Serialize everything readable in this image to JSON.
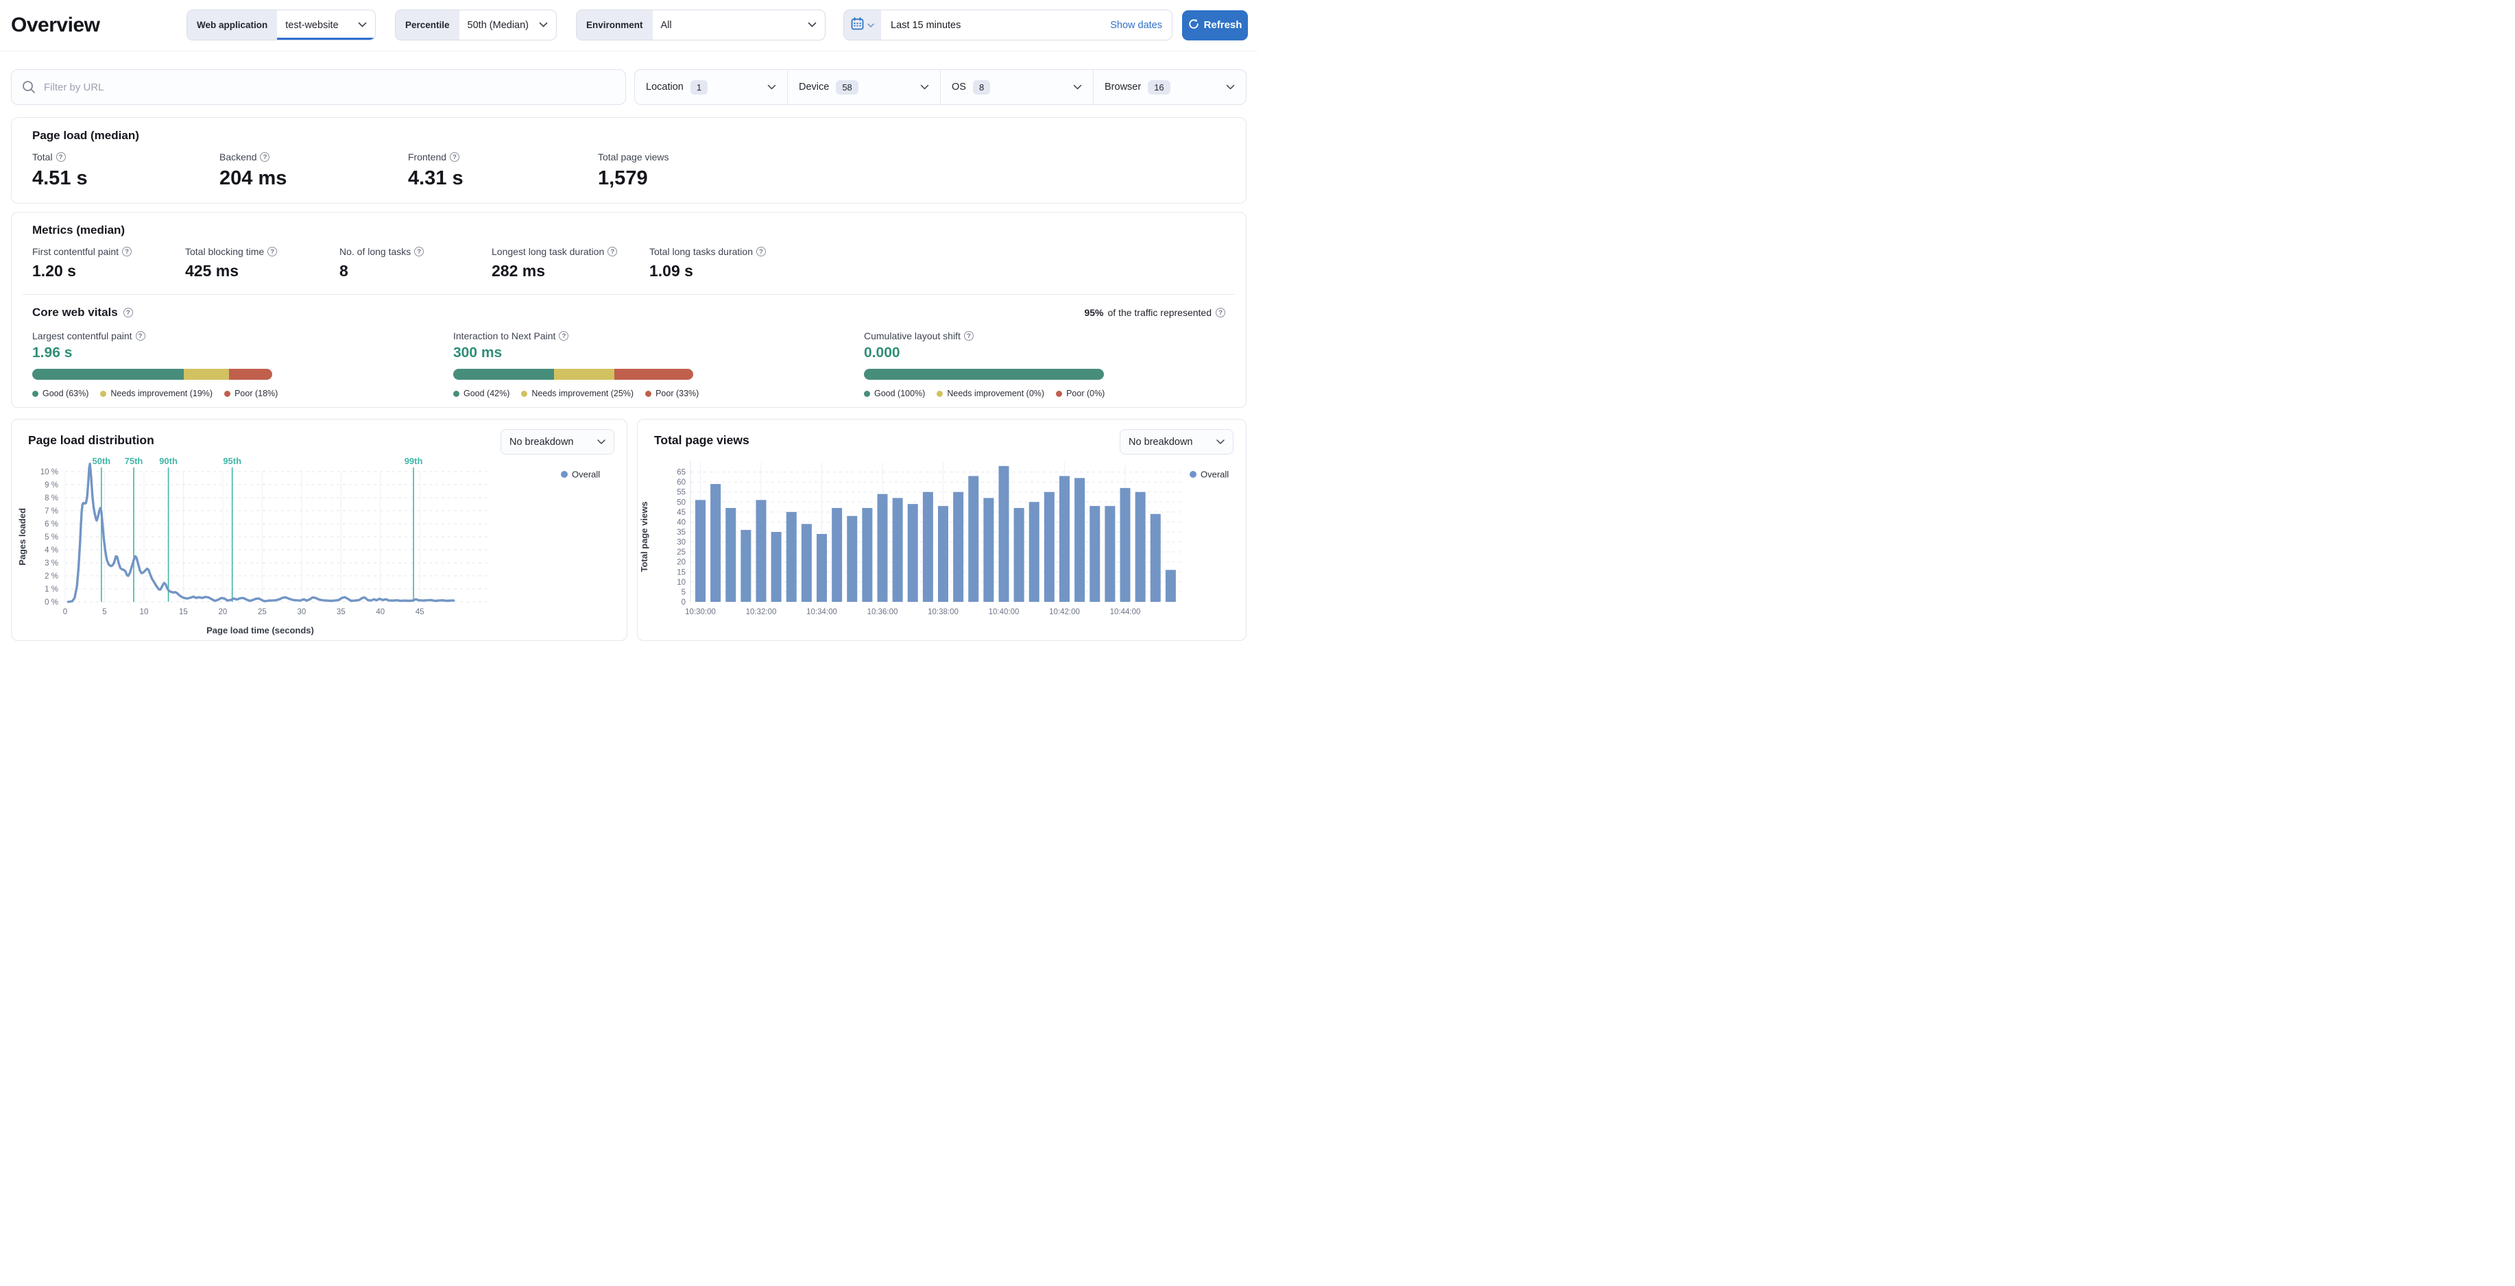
{
  "header": {
    "title": "Overview",
    "controls": {
      "web_application": {
        "label": "Web application",
        "value": "test-website"
      },
      "percentile": {
        "label": "Percentile",
        "value": "50th (Median)"
      },
      "environment": {
        "label": "Environment",
        "value": "All"
      },
      "date_range": {
        "value": "Last 15 minutes",
        "show_dates_label": "Show dates"
      },
      "refresh_label": "Refresh"
    }
  },
  "filters": {
    "url_filter_placeholder": "Filter by URL",
    "dropdowns": [
      {
        "label": "Location",
        "count": "1"
      },
      {
        "label": "Device",
        "count": "58"
      },
      {
        "label": "OS",
        "count": "8"
      },
      {
        "label": "Browser",
        "count": "16"
      }
    ]
  },
  "page_load": {
    "title": "Page load (median)",
    "metrics": [
      {
        "label": "Total",
        "value": "4.51 s"
      },
      {
        "label": "Backend",
        "value": "204 ms"
      },
      {
        "label": "Frontend",
        "value": "4.31 s"
      },
      {
        "label": "Total page views",
        "value": "1,579"
      }
    ]
  },
  "metrics_section": {
    "title": "Metrics (median)",
    "metrics": [
      {
        "label": "First contentful paint",
        "value": "1.20 s"
      },
      {
        "label": "Total blocking time",
        "value": "425 ms"
      },
      {
        "label": "No. of long tasks",
        "value": "8"
      },
      {
        "label": "Longest long task duration",
        "value": "282 ms"
      },
      {
        "label": "Total long tasks duration",
        "value": "1.09 s"
      }
    ]
  },
  "core_web_vitals": {
    "title": "Core web vitals",
    "traffic_pct": "95%",
    "traffic_text": "of the traffic represented",
    "vitals": [
      {
        "label": "Largest contentful paint",
        "value": "1.96 s",
        "good_pct": 63,
        "ni_pct": 19,
        "poor_pct": 18,
        "legend": [
          "Good (63%)",
          "Needs improvement (19%)",
          "Poor (18%)"
        ]
      },
      {
        "label": "Interaction to Next Paint",
        "value": "300 ms",
        "good_pct": 42,
        "ni_pct": 25,
        "poor_pct": 33,
        "legend": [
          "Good (42%)",
          "Needs improvement (25%)",
          "Poor (33%)"
        ]
      },
      {
        "label": "Cumulative layout shift",
        "value": "0.000",
        "good_pct": 100,
        "ni_pct": 0,
        "poor_pct": 0,
        "legend": [
          "Good (100%)",
          "Needs improvement (0%)",
          "Poor (0%)"
        ]
      }
    ]
  },
  "charts_ui": {
    "breakdown_dropdowns": [
      {
        "value": "No breakdown"
      },
      {
        "value": "No breakdown"
      }
    ]
  },
  "colors": {
    "accent_blue": "#2f72c6",
    "link_blue": "#2e70c8",
    "underline_blue": "#2f6fd0",
    "series_blue": "#7295c5",
    "legend_dot_blue": "#6f94c9",
    "teal_marker": "#3fb7a6",
    "teal_value_text": "#2f8f78",
    "good_green": "#478d7c",
    "needs_improvement_yellow": "#d1c160",
    "poor_red": "#c05f4c"
  },
  "chart_data": [
    {
      "type": "line",
      "title": "Page load distribution",
      "xlabel": "Page load time (seconds)",
      "ylabel": "Pages loaded",
      "series_name": "Overall",
      "xlim": [
        0,
        49.5
      ],
      "ylim": [
        0,
        10.8
      ],
      "x_ticks": [
        0,
        5,
        10,
        15,
        20,
        25,
        30,
        35,
        40,
        45
      ],
      "y_ticks": [
        0,
        1,
        2,
        3,
        4,
        5,
        6,
        7,
        8,
        9,
        10
      ],
      "y_tick_suffix": " %",
      "grid": true,
      "legend_position": "top-right",
      "percentile_markers": [
        {
          "label": "50th",
          "x": 4.6
        },
        {
          "label": "75th",
          "x": 8.7
        },
        {
          "label": "90th",
          "x": 13.1
        },
        {
          "label": "95th",
          "x": 21.2
        },
        {
          "label": "99th",
          "x": 44.2
        }
      ],
      "points": [
        [
          0.4,
          0
        ],
        [
          0.9,
          0.05
        ],
        [
          1.2,
          0.3
        ],
        [
          1.5,
          1.2
        ],
        [
          1.7,
          2.6
        ],
        [
          1.9,
          4.6
        ],
        [
          2.0,
          5.9
        ],
        [
          2.1,
          6.9
        ],
        [
          2.2,
          7.5
        ],
        [
          2.35,
          7.6
        ],
        [
          2.5,
          7.55
        ],
        [
          2.65,
          7.6
        ],
        [
          2.8,
          8.1
        ],
        [
          2.95,
          9.3
        ],
        [
          3.05,
          10.3
        ],
        [
          3.15,
          10.6
        ],
        [
          3.3,
          9.6
        ],
        [
          3.45,
          8.2
        ],
        [
          3.6,
          7.3
        ],
        [
          3.75,
          6.8
        ],
        [
          3.9,
          6.4
        ],
        [
          4.0,
          6.25
        ],
        [
          4.15,
          6.5
        ],
        [
          4.3,
          6.9
        ],
        [
          4.45,
          7.2
        ],
        [
          4.6,
          6.9
        ],
        [
          4.75,
          5.9
        ],
        [
          4.9,
          4.9
        ],
        [
          5.1,
          3.9
        ],
        [
          5.3,
          3.2
        ],
        [
          5.55,
          2.85
        ],
        [
          5.8,
          2.75
        ],
        [
          6.0,
          2.8
        ],
        [
          6.2,
          3.0
        ],
        [
          6.45,
          3.5
        ],
        [
          6.6,
          3.45
        ],
        [
          6.8,
          2.95
        ],
        [
          7.0,
          2.6
        ],
        [
          7.2,
          2.5
        ],
        [
          7.45,
          2.45
        ],
        [
          7.65,
          2.35
        ],
        [
          7.85,
          2.05
        ],
        [
          8.0,
          2.0
        ],
        [
          8.2,
          2.2
        ],
        [
          8.45,
          2.7
        ],
        [
          8.7,
          3.2
        ],
        [
          8.9,
          3.5
        ],
        [
          9.05,
          3.4
        ],
        [
          9.25,
          2.95
        ],
        [
          9.5,
          2.4
        ],
        [
          9.7,
          2.2
        ],
        [
          9.9,
          2.25
        ],
        [
          10.15,
          2.4
        ],
        [
          10.4,
          2.55
        ],
        [
          10.6,
          2.45
        ],
        [
          10.8,
          2.1
        ],
        [
          11.0,
          1.8
        ],
        [
          11.3,
          1.5
        ],
        [
          11.6,
          1.2
        ],
        [
          11.9,
          0.95
        ],
        [
          12.1,
          0.95
        ],
        [
          12.35,
          1.25
        ],
        [
          12.55,
          1.45
        ],
        [
          12.75,
          1.35
        ],
        [
          12.95,
          1.05
        ],
        [
          13.15,
          0.85
        ],
        [
          13.4,
          0.78
        ],
        [
          13.7,
          0.72
        ],
        [
          13.95,
          0.75
        ],
        [
          14.2,
          0.68
        ],
        [
          14.5,
          0.5
        ],
        [
          14.8,
          0.38
        ],
        [
          15.1,
          0.3
        ],
        [
          15.5,
          0.26
        ],
        [
          15.9,
          0.32
        ],
        [
          16.3,
          0.4
        ],
        [
          16.6,
          0.3
        ],
        [
          17.0,
          0.36
        ],
        [
          17.4,
          0.3
        ],
        [
          17.8,
          0.38
        ],
        [
          18.2,
          0.34
        ],
        [
          18.6,
          0.2
        ],
        [
          19.0,
          0.08
        ],
        [
          19.4,
          0.16
        ],
        [
          19.8,
          0.3
        ],
        [
          20.2,
          0.26
        ],
        [
          20.6,
          0.1
        ],
        [
          21.0,
          0.14
        ],
        [
          21.4,
          0.26
        ],
        [
          21.8,
          0.18
        ],
        [
          22.2,
          0.28
        ],
        [
          22.6,
          0.3
        ],
        [
          23.0,
          0.18
        ],
        [
          23.4,
          0.08
        ],
        [
          23.8,
          0.14
        ],
        [
          24.2,
          0.24
        ],
        [
          24.6,
          0.26
        ],
        [
          25.0,
          0.12
        ],
        [
          25.4,
          0.05
        ],
        [
          25.8,
          0.1
        ],
        [
          26.2,
          0.1
        ],
        [
          26.7,
          0.12
        ],
        [
          27.2,
          0.2
        ],
        [
          27.6,
          0.32
        ],
        [
          28.0,
          0.34
        ],
        [
          28.4,
          0.24
        ],
        [
          28.8,
          0.16
        ],
        [
          29.3,
          0.12
        ],
        [
          29.8,
          0.1
        ],
        [
          30.3,
          0.2
        ],
        [
          30.6,
          0.1
        ],
        [
          31.0,
          0.18
        ],
        [
          31.4,
          0.34
        ],
        [
          31.8,
          0.3
        ],
        [
          32.2,
          0.18
        ],
        [
          32.7,
          0.12
        ],
        [
          33.2,
          0.1
        ],
        [
          33.7,
          0.08
        ],
        [
          34.2,
          0.1
        ],
        [
          34.7,
          0.14
        ],
        [
          35.1,
          0.3
        ],
        [
          35.5,
          0.36
        ],
        [
          35.9,
          0.22
        ],
        [
          36.3,
          0.08
        ],
        [
          36.8,
          0.1
        ],
        [
          37.3,
          0.14
        ],
        [
          37.7,
          0.3
        ],
        [
          38.0,
          0.34
        ],
        [
          38.4,
          0.14
        ],
        [
          38.8,
          0.1
        ],
        [
          39.2,
          0.2
        ],
        [
          39.5,
          0.12
        ],
        [
          39.9,
          0.24
        ],
        [
          40.3,
          0.14
        ],
        [
          40.7,
          0.2
        ],
        [
          41.1,
          0.1
        ],
        [
          41.6,
          0.1
        ],
        [
          42.1,
          0.12
        ],
        [
          42.6,
          0.08
        ],
        [
          43.1,
          0.1
        ],
        [
          43.6,
          0.08
        ],
        [
          44.1,
          0.1
        ],
        [
          44.5,
          0.2
        ],
        [
          44.9,
          0.12
        ],
        [
          45.4,
          0.1
        ],
        [
          45.9,
          0.12
        ],
        [
          46.4,
          0.14
        ],
        [
          46.9,
          0.08
        ],
        [
          47.4,
          0.1
        ],
        [
          47.9,
          0.12
        ],
        [
          48.4,
          0.08
        ],
        [
          48.9,
          0.1
        ],
        [
          49.3,
          0.1
        ]
      ]
    },
    {
      "type": "bar",
      "title": "Total page views",
      "xlabel": "",
      "ylabel": "Total page views",
      "series_name": "Overall",
      "ylim": [
        0,
        70
      ],
      "y_ticks": [
        0,
        5,
        10,
        15,
        20,
        25,
        30,
        35,
        40,
        45,
        50,
        55,
        60,
        65
      ],
      "grid": true,
      "legend_position": "top-right",
      "categories": [
        "10:30:00",
        "10:30:30",
        "10:31:00",
        "10:31:30",
        "10:32:00",
        "10:32:30",
        "10:33:00",
        "10:33:30",
        "10:34:00",
        "10:34:30",
        "10:35:00",
        "10:35:30",
        "10:36:00",
        "10:36:30",
        "10:37:00",
        "10:37:30",
        "10:38:00",
        "10:38:30",
        "10:39:00",
        "10:39:30",
        "10:40:00",
        "10:40:30",
        "10:41:00",
        "10:41:30",
        "10:42:00",
        "10:42:30",
        "10:43:00",
        "10:43:30",
        "10:44:00",
        "10:44:30",
        "10:45:00",
        "10:45:30"
      ],
      "tick_indices": [
        0,
        4,
        8,
        12,
        16,
        20,
        24,
        28
      ],
      "values": [
        51,
        59,
        47,
        36,
        51,
        35,
        45,
        39,
        34,
        47,
        43,
        47,
        54,
        52,
        49,
        55,
        48,
        55,
        63,
        52,
        68,
        47,
        50,
        55,
        63,
        62,
        48,
        48,
        57,
        55,
        44,
        16
      ]
    }
  ]
}
